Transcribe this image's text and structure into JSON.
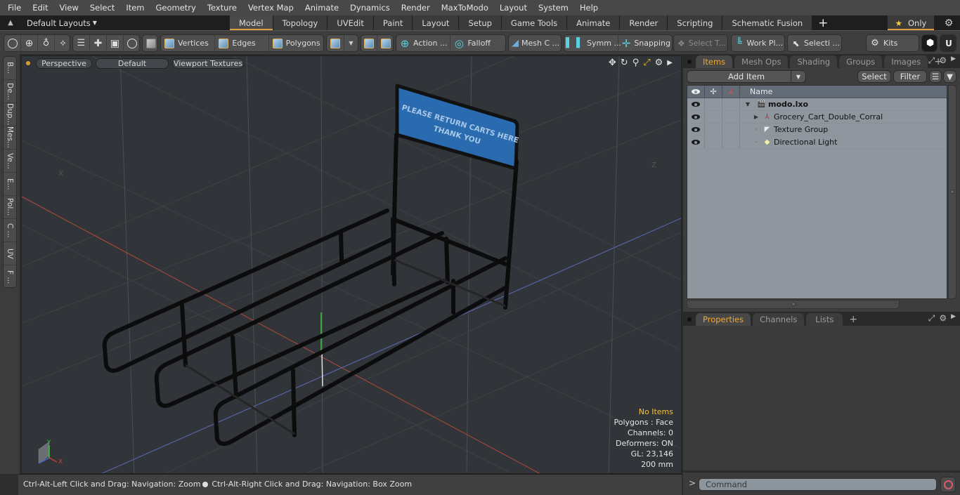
{
  "menu": [
    "File",
    "Edit",
    "View",
    "Select",
    "Item",
    "Geometry",
    "Texture",
    "Vertex Map",
    "Animate",
    "Dynamics",
    "Render",
    "MaxToModo",
    "Layout",
    "System",
    "Help"
  ],
  "layout_bar": {
    "dropdown_label": "Default Layouts",
    "tabs": [
      {
        "label": "Model",
        "active": true
      },
      {
        "label": "Topology"
      },
      {
        "label": "UVEdit"
      },
      {
        "label": "Paint"
      },
      {
        "label": "Layout"
      },
      {
        "label": "Setup"
      },
      {
        "label": "Game Tools"
      },
      {
        "label": "Animate"
      },
      {
        "label": "Render"
      },
      {
        "label": "Scripting"
      },
      {
        "label": "Schematic Fusion"
      }
    ],
    "add_tab_label": "+",
    "only_label": "Only"
  },
  "toolbar": {
    "vertices": "Vertices",
    "edges": "Edges",
    "polygons": "Polygons",
    "action": "Action ...",
    "falloff": "Falloff",
    "mesh_constraints": "Mesh C ...",
    "symmetry": "Symm ...",
    "snapping": "Snapping",
    "select_through": "Select T...",
    "work_plane": "Work Pl...",
    "selection_sets": "Selecti ...",
    "kits": "Kits"
  },
  "left_tabs": [
    "B...",
    "De...",
    "Dup...",
    "Mes...",
    "Ve...",
    "E...",
    "Pol...",
    "C ...",
    "UV",
    "F ..."
  ],
  "viewport": {
    "view_mode": "Perspective",
    "shading": "Default",
    "textures": "Viewport Textures",
    "sign_line1": "PLEASE RETURN CARTS HERE",
    "sign_line2": "THANK YOU",
    "axis_labels": {
      "x": "X",
      "y": "Y",
      "z": "Z"
    },
    "stats": {
      "selection": "No Items",
      "polygons": "Polygons : Face",
      "channels": "Channels: 0",
      "deformers": "Deformers: ON",
      "gl": "GL: 23,146",
      "scale": "200 mm"
    }
  },
  "status_bar": {
    "hint1": "Ctrl-Alt-Left Click and Drag: Navigation: Zoom",
    "hint2": "Ctrl-Alt-Right Click and Drag: Navigation: Box Zoom"
  },
  "items_panel": {
    "tabs": [
      {
        "label": "Items",
        "active": true
      },
      {
        "label": "Mesh Ops"
      },
      {
        "label": "Shading"
      },
      {
        "label": "Groups"
      },
      {
        "label": "Images"
      }
    ],
    "add_item": "Add Item",
    "select": "Select",
    "filter": "Filter",
    "column_name": "Name",
    "rows": [
      {
        "name": "modo.lxo",
        "icon": "scene-icon",
        "expander": "▼",
        "bold": true,
        "indent": 0
      },
      {
        "name": "Grocery_Cart_Double_Corral",
        "icon": "mesh-locator-icon",
        "expander": "▶",
        "indent": 1
      },
      {
        "name": "Texture Group",
        "icon": "texture-group-icon",
        "expander": "·",
        "indent": 1
      },
      {
        "name": "Directional Light",
        "icon": "light-icon",
        "expander": "·",
        "indent": 1
      }
    ]
  },
  "properties_panel": {
    "tabs": [
      {
        "label": "Properties",
        "active": true
      },
      {
        "label": "Channels"
      },
      {
        "label": "Lists"
      }
    ]
  },
  "command": {
    "prompt": ">",
    "placeholder": "Command"
  },
  "colors": {
    "accent": "#e0a040",
    "sign_blue": "#2a6bb0",
    "viewport_bg": "#313539"
  }
}
